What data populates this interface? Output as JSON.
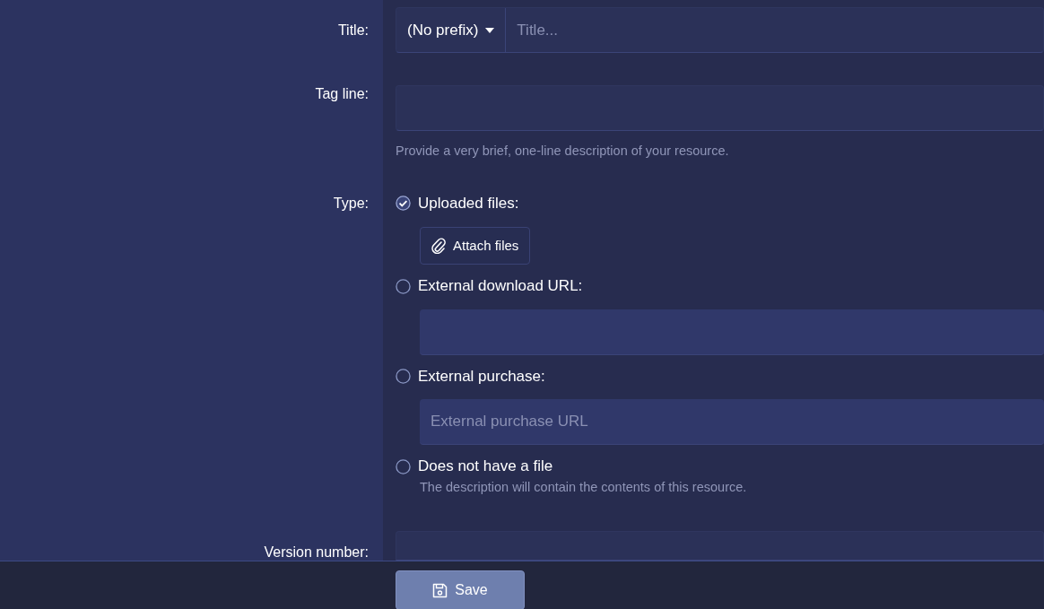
{
  "title_row": {
    "label": "Title:",
    "prefix": "(No prefix)",
    "placeholder": "Title..."
  },
  "tag_line": {
    "label": "Tag line:",
    "hint": "Provide a very brief, one-line description of your resource."
  },
  "type": {
    "label": "Type:",
    "options": [
      {
        "label": "Uploaded files:",
        "selected": true,
        "kind": "button",
        "button": "Attach files"
      },
      {
        "label": "External download URL:",
        "selected": false,
        "kind": "field"
      },
      {
        "label": "External purchase:",
        "selected": false,
        "kind": "field",
        "placeholder": "External purchase URL"
      },
      {
        "label": "Does not have a file",
        "selected": false,
        "kind": "hint",
        "hint": "The description will contain the contents of this resource."
      }
    ]
  },
  "version": {
    "label": "Version number:"
  },
  "footer": {
    "button": "Save"
  }
}
